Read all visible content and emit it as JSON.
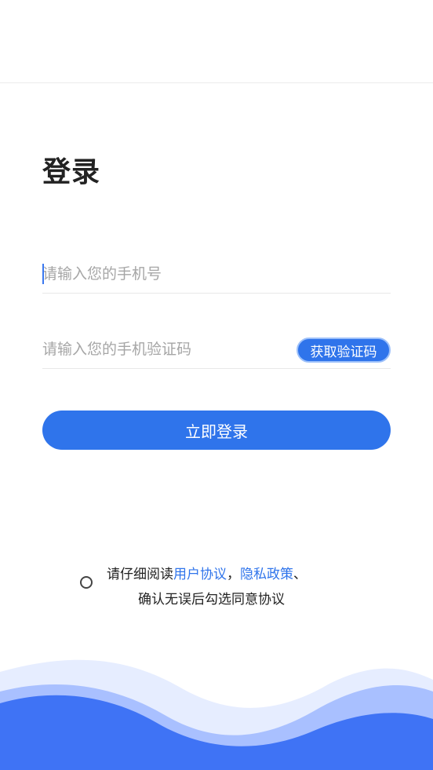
{
  "login": {
    "title": "登录",
    "phone_placeholder": "请输入您的手机号",
    "code_placeholder": "请输入您的手机验证码",
    "get_code_label": "获取验证码",
    "submit_label": "立即登录"
  },
  "agreement": {
    "prefix": "请仔细阅读",
    "user_agreement": "用户协议",
    "comma": "，",
    "privacy_policy": "隐私政策",
    "suffix": "、",
    "line2": "确认无误后勾选同意协议",
    "checked": false
  },
  "colors": {
    "accent": "#2f74eb",
    "wave_light": "#e6edff",
    "wave_mid": "#a9c0ff",
    "wave_dark": "#3f73f5"
  }
}
